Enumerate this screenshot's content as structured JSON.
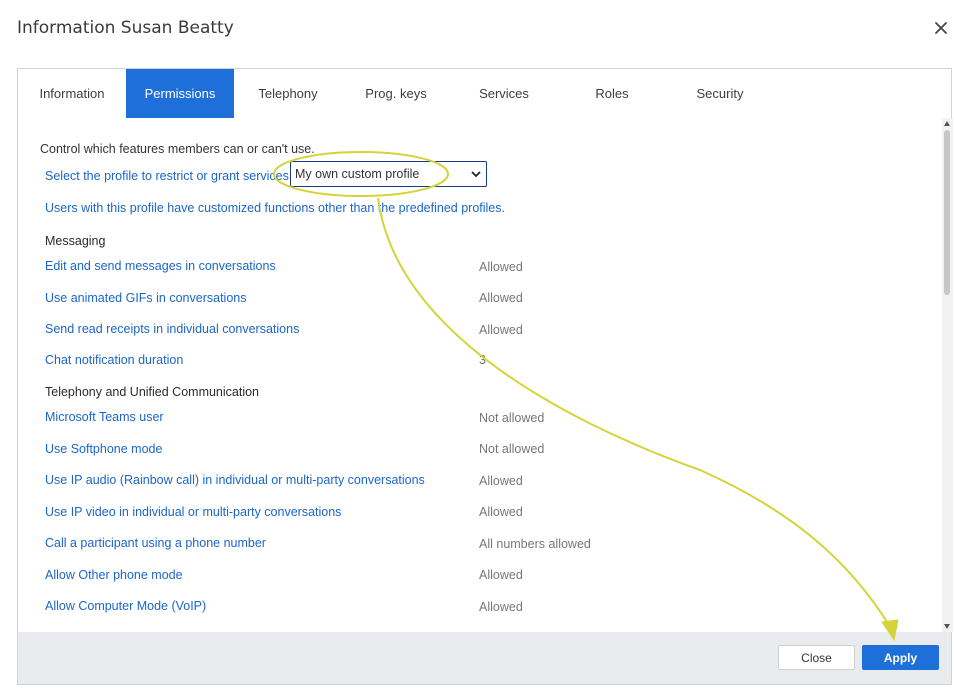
{
  "dialog": {
    "title": "Information Susan Beatty"
  },
  "tabs": [
    {
      "label": "Information",
      "active": false
    },
    {
      "label": "Permissions",
      "active": true
    },
    {
      "label": "Telephony",
      "active": false
    },
    {
      "label": "Prog. keys",
      "active": false
    },
    {
      "label": "Services",
      "active": false
    },
    {
      "label": "Roles",
      "active": false
    },
    {
      "label": "Security",
      "active": false
    }
  ],
  "permissions": {
    "intro": "Control which features members can or can't use.",
    "profile_prompt": "Select the profile to restrict or grant services",
    "profile_value": "My own custom profile",
    "profile_note": "Users with this profile have customized functions other than the predefined profiles.",
    "sections": [
      {
        "title": "Messaging",
        "rows": [
          {
            "label": "Edit and send messages in conversations",
            "value": "Allowed"
          },
          {
            "label": "Use animated GIFs in conversations",
            "value": "Allowed"
          },
          {
            "label": "Send read receipts in individual conversations",
            "value": "Allowed"
          },
          {
            "label": "Chat notification duration",
            "value": "3"
          }
        ]
      },
      {
        "title": "Telephony and Unified Communication",
        "rows": [
          {
            "label": "Microsoft Teams user",
            "value": "Not allowed"
          },
          {
            "label": "Use Softphone mode",
            "value": "Not allowed"
          },
          {
            "label": "Use IP audio (Rainbow call) in individual or multi-party conversations",
            "value": "Allowed"
          },
          {
            "label": "Use IP video in individual or multi-party conversations",
            "value": "Allowed"
          },
          {
            "label": "Call a participant using a phone number",
            "value": "All numbers allowed"
          },
          {
            "label": "Allow Other phone mode",
            "value": "Allowed"
          },
          {
            "label": "Allow Computer Mode (VoIP)",
            "value": "Allowed"
          }
        ]
      }
    ]
  },
  "footer": {
    "close_label": "Close",
    "apply_label": "Apply"
  },
  "colors": {
    "accent": "#1e6fd9",
    "link": "#1b66c9",
    "annotation": "#d4d43a"
  }
}
